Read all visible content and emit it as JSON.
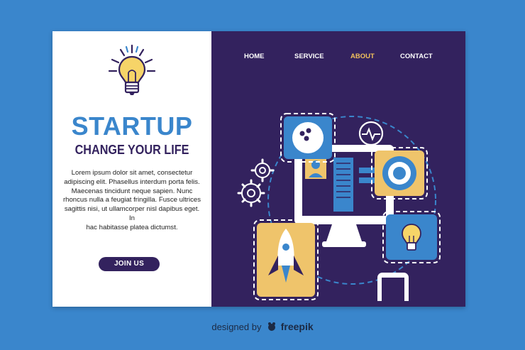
{
  "hero": {
    "title": "STARTUP",
    "subtitle": "CHANGE YOUR LIFE",
    "body_lines": [
      "Lorem ipsum dolor sit amet, consectetur",
      "adipiscing elit. Phasellus interdum porta felis.",
      "Maecenas tincidunt neque sapien. Nunc",
      "rhoncus nulla a feugiat fringilla. Fusce ultrices",
      "sagittis nisi, ut ullamcorper nisl dapibus eget. In",
      "hac habitasse platea dictumst."
    ],
    "cta_label": "JOIN US"
  },
  "nav": {
    "items": [
      {
        "label": "HOME",
        "active": false
      },
      {
        "label": "SERVICE",
        "active": false
      },
      {
        "label": "ABOUT",
        "active": true
      },
      {
        "label": "CONTACT",
        "active": false
      }
    ]
  },
  "footer": {
    "prefix": "designed by",
    "brand": "freepik"
  },
  "colors": {
    "background": "#3a86cc",
    "panel_dark": "#33225e",
    "accent_blue": "#3a86cc",
    "accent_yellow": "#efc46b",
    "nav_active": "#f2c15c"
  },
  "icons": [
    "lightbulb-icon",
    "bowling-ball-icon",
    "heartbeat-icon",
    "target-icon",
    "gear-icon",
    "monitor-icon",
    "profile-card-icon",
    "rocket-icon",
    "lightbulb-small-icon",
    "smartphone-icon",
    "freepik-logo-icon"
  ]
}
